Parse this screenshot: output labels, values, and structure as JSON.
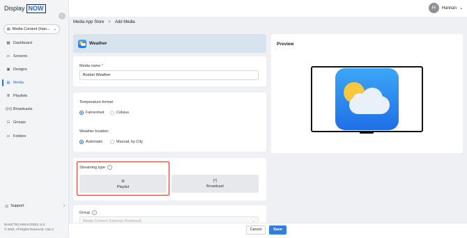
{
  "logo": {
    "part1": "Display",
    "part2": "NOW"
  },
  "sidebar": {
    "workspace": "Media Content (Han...",
    "items": [
      {
        "label": "Dashboard",
        "icon": "dashboard-icon",
        "active": false
      },
      {
        "label": "Screens",
        "icon": "screens-icon",
        "active": false
      },
      {
        "label": "Designs",
        "icon": "designs-icon",
        "active": false
      },
      {
        "label": "Media",
        "icon": "media-icon",
        "active": true
      },
      {
        "label": "Playlists",
        "icon": "playlists-icon",
        "active": false
      },
      {
        "label": "Broadcasts",
        "icon": "broadcasts-icon",
        "active": false
      },
      {
        "label": "Groups",
        "icon": "groups-icon",
        "active": false
      },
      {
        "label": "Folders",
        "icon": "folders-icon",
        "active": false
      }
    ],
    "support": "Support",
    "footer_company": "DUKE TECHNOLOGIES LLC",
    "footer_rights": "© 2025. All Rights Reserved. V25.2"
  },
  "user": {
    "initial": "H",
    "name": "Hannan"
  },
  "breadcrumb": {
    "parent": "Media App Store",
    "separator": ">",
    "current": "Add Media"
  },
  "app": {
    "title": "Weather"
  },
  "form": {
    "media_name_label": "Media name",
    "media_name_required": "*",
    "media_name_value": "Boston Weather",
    "temperature_label": "Temperature format",
    "temperature_options": [
      "Fahrenheit",
      "Celsius"
    ],
    "temperature_selected": "Fahrenheit",
    "location_label": "Weather location:",
    "location_options": [
      "Automatic",
      "Manual, by City"
    ],
    "location_selected": "Automatic",
    "streaming_label": "Streaming type",
    "streaming_options": [
      "Playlist",
      "Broadcast"
    ],
    "group_label": "Group",
    "group_value": "Media Content (Hannan Rasheed)"
  },
  "actions": {
    "cancel": "Cancel",
    "save": "Save"
  },
  "preview": {
    "title": "Preview"
  },
  "colors": {
    "accent": "#1e6fd9",
    "highlight": "#d9382b",
    "header_bg": "#d7e3ef"
  }
}
